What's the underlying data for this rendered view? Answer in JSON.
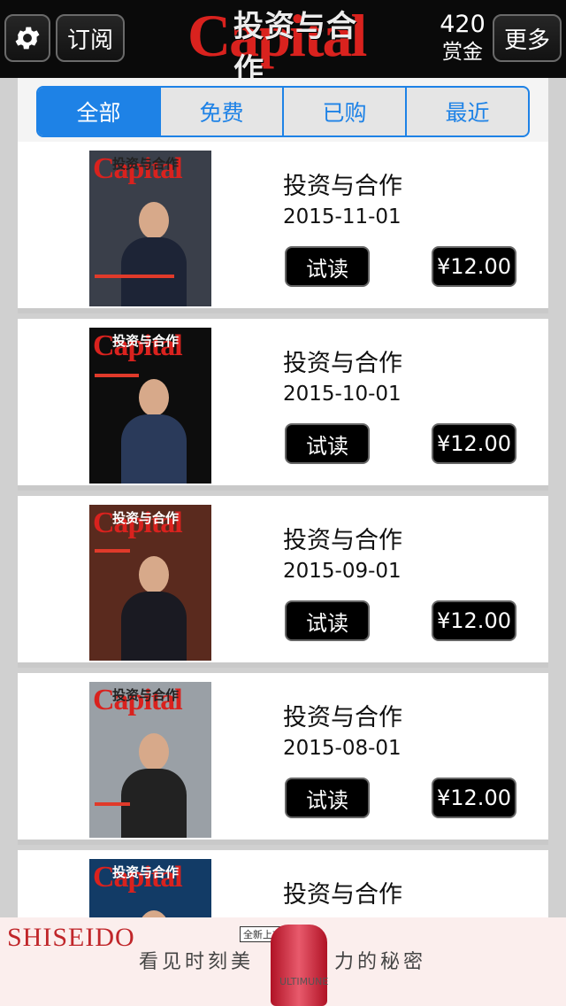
{
  "header": {
    "settings_icon": "gear-icon",
    "subscribe_label": "订阅",
    "logo_text": "Capital",
    "logo_cn": "投资与合作",
    "bounty_value": "420",
    "bounty_label": "赏金",
    "more_label": "更多"
  },
  "tabs": [
    {
      "label": "全部",
      "active": true
    },
    {
      "label": "免费",
      "active": false
    },
    {
      "label": "已购",
      "active": false
    },
    {
      "label": "最近",
      "active": false
    }
  ],
  "issues": [
    {
      "title": "投资与合作",
      "date": "2015-11-01",
      "try_label": "试读",
      "price": "¥12.00",
      "cover_bg": "#3a3f4a"
    },
    {
      "title": "投资与合作",
      "date": "2015-10-01",
      "try_label": "试读",
      "price": "¥12.00",
      "cover_bg": "#0d0d0d"
    },
    {
      "title": "投资与合作",
      "date": "2015-09-01",
      "try_label": "试读",
      "price": "¥12.00",
      "cover_bg": "#5a2a1e"
    },
    {
      "title": "投资与合作",
      "date": "2015-08-01",
      "try_label": "试读",
      "price": "¥12.00",
      "cover_bg": "#9aa0a6"
    },
    {
      "title": "投资与合作",
      "date": "",
      "try_label": "",
      "price": "",
      "cover_bg": "#123b66"
    }
  ],
  "ad": {
    "brand": "SHISEIDO",
    "badge": "全新上市",
    "text_left": "看见时刻美",
    "text_right": "力的秘密",
    "product": "ULTIMUNE"
  }
}
